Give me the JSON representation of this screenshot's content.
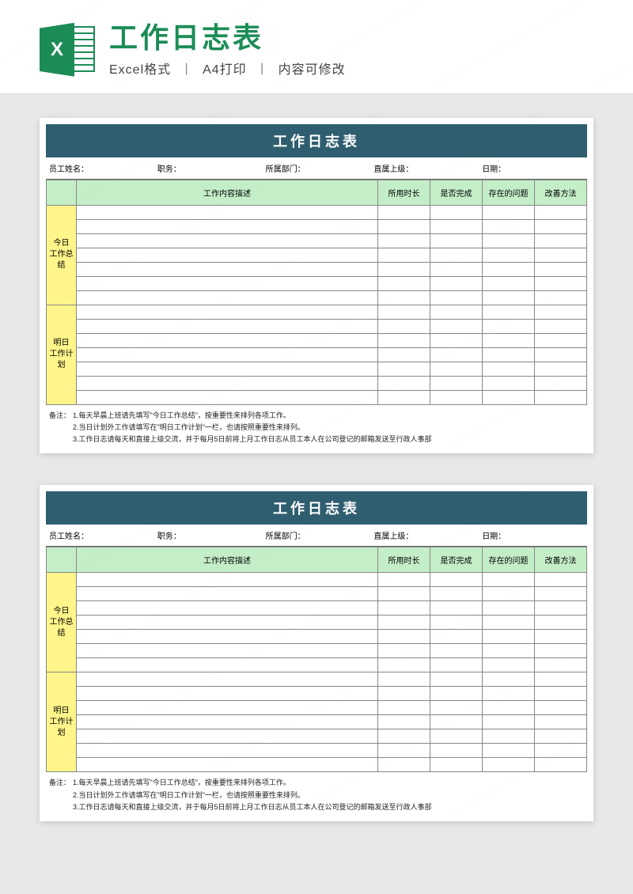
{
  "header": {
    "icon_letter": "X",
    "title": "工作日志表",
    "sub_format": "Excel格式",
    "sub_print": "A4打印",
    "sub_editable": "内容可修改"
  },
  "sheet": {
    "title": "工作日志表",
    "info": {
      "employee_name_label": "员工姓名：",
      "position_label": "职务：",
      "department_label": "所属部门：",
      "supervisor_label": "直属上级：",
      "date_label": "日期："
    },
    "columns": {
      "blank": "",
      "description": "工作内容描述",
      "duration": "所用时长",
      "completed": "是否完成",
      "problems": "存在的问题",
      "improvement": "改善方法"
    },
    "sections": {
      "today_summary": "今日\n工作总结",
      "tomorrow_plan": "明日\n工作计划"
    },
    "notes": {
      "label": "备注：",
      "n1": "1.每天早晨上班请先填写\"今日工作总结\"，按重要性来排列各项工作。",
      "n2": "2.当日计划外工作请填写在\"明日工作计划\"一栏，也请按照重要性来排列。",
      "n3": "3.工作日志请每天和直接上级交流，并于每月5日前将上月工作日志从员工本人在公司登记的邮箱发送至行政人事部"
    }
  }
}
